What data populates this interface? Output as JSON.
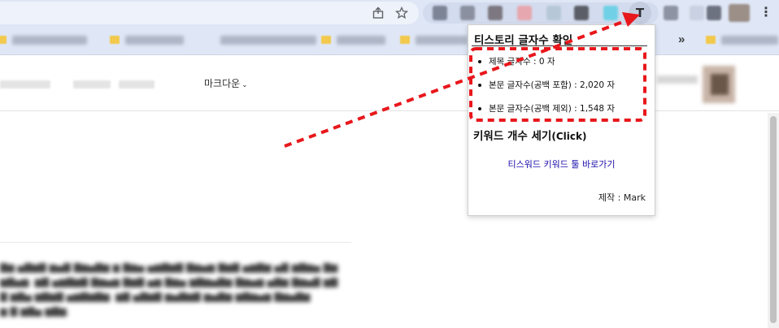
{
  "colors": {
    "annotation": "#e8171c",
    "link": "#1a0dab",
    "toolbar_bg": "#dfe6f5"
  },
  "browser": {
    "omnibox_icons": [
      "share-icon",
      "star-icon"
    ],
    "active_extension_glyph": "T",
    "menu_glyph": "⋮",
    "bookmarks_overflow_glyph": "»"
  },
  "editor": {
    "mode_select": "마크다운"
  },
  "popup": {
    "title": "티스토리 글자수 확인",
    "counts": [
      {
        "label": "제목 글자수 : 0 자"
      },
      {
        "label": "본문 글자수(공백 포함) : 2,020 자"
      },
      {
        "label": "본문 글자수(공백 제외) : 1,548 자"
      }
    ],
    "keyword_heading": "키워드 개수 세기",
    "keyword_heading_suffix": "(Click)",
    "keyword_link": "티스워드 키워드 툴 바로가기",
    "maker": "제작 : Mark"
  }
}
